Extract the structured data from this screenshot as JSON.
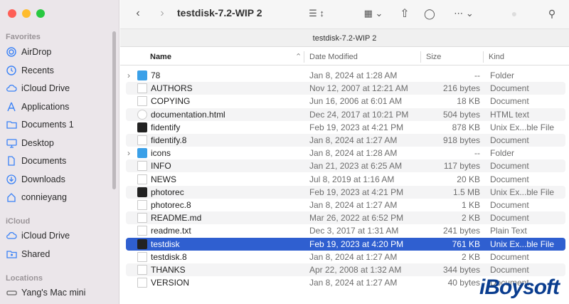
{
  "window": {
    "title": "testdisk-7.2-WIP 2",
    "path_title": "testdisk-7.2-WIP 2"
  },
  "sidebar": {
    "favorites_label": "Favorites",
    "favorites": [
      {
        "label": "AirDrop",
        "icon": "airdrop-icon"
      },
      {
        "label": "Recents",
        "icon": "clock-icon"
      },
      {
        "label": "iCloud Drive",
        "icon": "cloud-icon"
      },
      {
        "label": "Applications",
        "icon": "applications-icon"
      },
      {
        "label": "Documents 1",
        "icon": "folder-icon"
      },
      {
        "label": "Desktop",
        "icon": "desktop-icon"
      },
      {
        "label": "Documents",
        "icon": "document-icon"
      },
      {
        "label": "Downloads",
        "icon": "download-icon"
      },
      {
        "label": "connieyang",
        "icon": "home-icon"
      }
    ],
    "icloud_label": "iCloud",
    "icloud": [
      {
        "label": "iCloud Drive",
        "icon": "cloud-icon"
      },
      {
        "label": "Shared",
        "icon": "shared-folder-icon"
      }
    ],
    "locations_label": "Locations",
    "locations": [
      {
        "label": "Yang's Mac mini",
        "icon": "computer-icon"
      }
    ]
  },
  "columns": {
    "name": "Name",
    "date": "Date Modified",
    "size": "Size",
    "kind": "Kind"
  },
  "files": [
    {
      "name": "78",
      "date": "Jan 8, 2024 at 1:28 AM",
      "size": "--",
      "kind": "Folder",
      "type": "folder",
      "expandable": true
    },
    {
      "name": "AUTHORS",
      "date": "Nov 12, 2007 at 12:21 AM",
      "size": "216 bytes",
      "kind": "Document",
      "type": "doc"
    },
    {
      "name": "COPYING",
      "date": "Jun 16, 2006 at 6:01 AM",
      "size": "18 KB",
      "kind": "Document",
      "type": "doc"
    },
    {
      "name": "documentation.html",
      "date": "Dec 24, 2017 at 10:21 PM",
      "size": "504 bytes",
      "kind": "HTML text",
      "type": "html"
    },
    {
      "name": "fidentify",
      "date": "Feb 19, 2023 at 4:21 PM",
      "size": "878 KB",
      "kind": "Unix Ex...ble File",
      "type": "exec"
    },
    {
      "name": "fidentify.8",
      "date": "Jan 8, 2024 at 1:27 AM",
      "size": "918 bytes",
      "kind": "Document",
      "type": "doc"
    },
    {
      "name": "icons",
      "date": "Jan 8, 2024 at 1:28 AM",
      "size": "--",
      "kind": "Folder",
      "type": "folder",
      "expandable": true
    },
    {
      "name": "INFO",
      "date": "Jan 21, 2023 at 6:25 AM",
      "size": "117 bytes",
      "kind": "Document",
      "type": "doc"
    },
    {
      "name": "NEWS",
      "date": "Jul 8, 2019 at 1:16 AM",
      "size": "20 KB",
      "kind": "Document",
      "type": "doc"
    },
    {
      "name": "photorec",
      "date": "Feb 19, 2023 at 4:21 PM",
      "size": "1.5 MB",
      "kind": "Unix Ex...ble File",
      "type": "exec"
    },
    {
      "name": "photorec.8",
      "date": "Jan 8, 2024 at 1:27 AM",
      "size": "1 KB",
      "kind": "Document",
      "type": "doc"
    },
    {
      "name": "README.md",
      "date": "Mar 26, 2022 at 6:52 PM",
      "size": "2 KB",
      "kind": "Document",
      "type": "doc"
    },
    {
      "name": "readme.txt",
      "date": "Dec 3, 2017 at 1:31 AM",
      "size": "241 bytes",
      "kind": "Plain Text",
      "type": "doc"
    },
    {
      "name": "testdisk",
      "date": "Feb 19, 2023 at 4:20 PM",
      "size": "761 KB",
      "kind": "Unix Ex...ble File",
      "type": "exec",
      "selected": true
    },
    {
      "name": "testdisk.8",
      "date": "Jan 8, 2024 at 1:27 AM",
      "size": "2 KB",
      "kind": "Document",
      "type": "doc"
    },
    {
      "name": "THANKS",
      "date": "Apr 22, 2008 at 1:32 AM",
      "size": "344 bytes",
      "kind": "Document",
      "type": "doc"
    },
    {
      "name": "VERSION",
      "date": "Jan 8, 2024 at 1:27 AM",
      "size": "40 bytes",
      "kind": "Document",
      "type": "doc"
    }
  ],
  "watermark": "iBoysoft",
  "colors": {
    "selection": "#2f5fd0",
    "folder": "#3aa0e8"
  }
}
